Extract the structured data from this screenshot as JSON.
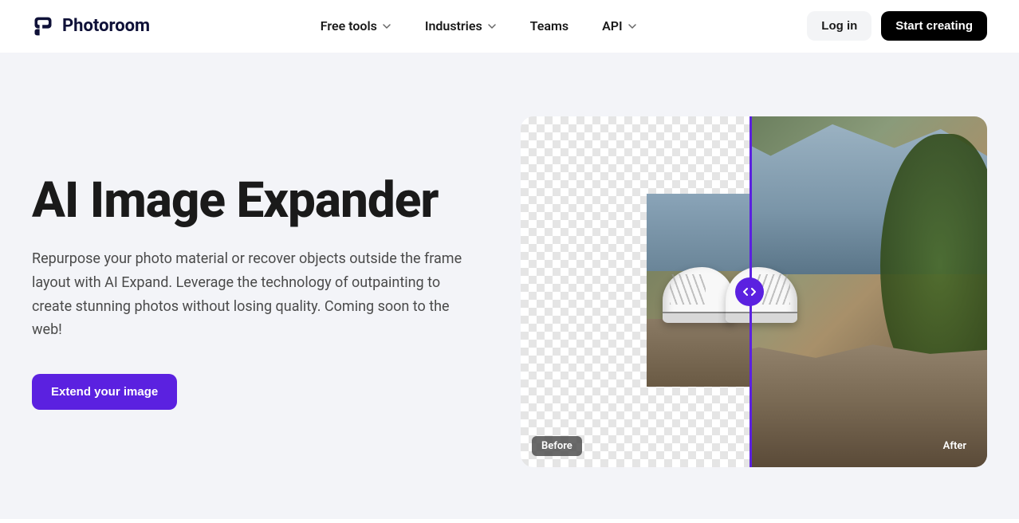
{
  "brand": {
    "name": "Photoroom"
  },
  "nav": {
    "items": [
      {
        "label": "Free tools",
        "hasDropdown": true
      },
      {
        "label": "Industries",
        "hasDropdown": true
      },
      {
        "label": "Teams",
        "hasDropdown": false
      },
      {
        "label": "API",
        "hasDropdown": true
      }
    ]
  },
  "header": {
    "login": "Log in",
    "startCreating": "Start creating"
  },
  "hero": {
    "title": "AI Image Expander",
    "description": "Repurpose your photo material or recover objects outside the frame layout with AI Expand. Leverage the technology of outpainting to create stunning photos without losing quality. Coming soon to the web!",
    "cta": "Extend your image",
    "beforeLabel": "Before",
    "afterLabel": "After"
  },
  "colors": {
    "accent": "#5b21e0",
    "heroBg": "#f3f4f8"
  }
}
